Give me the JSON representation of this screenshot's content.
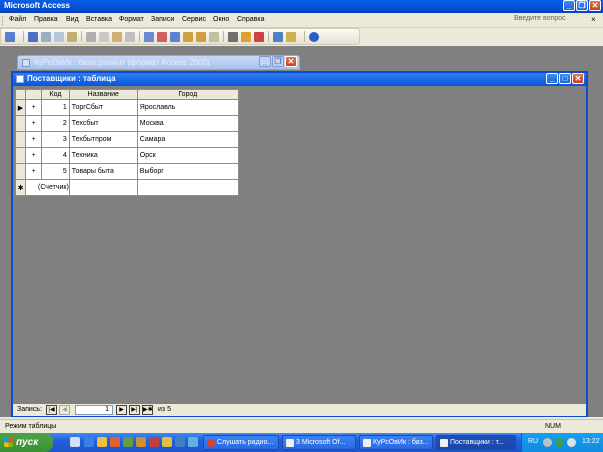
{
  "app": {
    "title": "Microsoft Access",
    "question_placeholder": "Введите вопрос",
    "close_glyph": "×"
  },
  "menu": [
    {
      "label": "Файл",
      "key": "Ф"
    },
    {
      "label": "Правка",
      "key": "П"
    },
    {
      "label": "Вид",
      "key": "В"
    },
    {
      "label": "Вставка",
      "key": "В"
    },
    {
      "label": "Формат",
      "key": "Ф"
    },
    {
      "label": "Записи",
      "key": "З"
    },
    {
      "label": "Сервис",
      "key": "С"
    },
    {
      "label": "Окно",
      "key": "О"
    },
    {
      "label": "Справка",
      "key": "С"
    }
  ],
  "db_window": {
    "title": "КуРсОвИк : база данных (формат Access 2000)"
  },
  "table_window": {
    "title": "Поставщики : таблица",
    "columns": [
      "Код",
      "Название",
      "Город"
    ],
    "rows": [
      {
        "id": "1",
        "name": "ТоргСбыт",
        "city": "Ярославль"
      },
      {
        "id": "2",
        "name": "Техсбыт",
        "city": "Москва"
      },
      {
        "id": "3",
        "name": "Техбытпром",
        "city": "Самара"
      },
      {
        "id": "4",
        "name": "Техника",
        "city": "Орск"
      },
      {
        "id": "5",
        "name": "Товары быта",
        "city": "Выборг"
      }
    ],
    "new_row_placeholder": "(Счетчик)",
    "expand_glyph": "+",
    "new_row_marker": "✱",
    "current_row_marker": "▶"
  },
  "navigator": {
    "label": "Запись:",
    "current": "1",
    "of_label": "из 5"
  },
  "statusbar": {
    "left": "Режим таблицы",
    "num": "NUM"
  },
  "taskbar": {
    "start": "пуск",
    "tasks": [
      {
        "label": "Слушать радио..."
      },
      {
        "label": "3 Microsoft Of..."
      },
      {
        "label": "КуРсОвИк : баз..."
      },
      {
        "label": "Поставщики : т..."
      }
    ],
    "lang": "RU",
    "clock": "13:22"
  }
}
